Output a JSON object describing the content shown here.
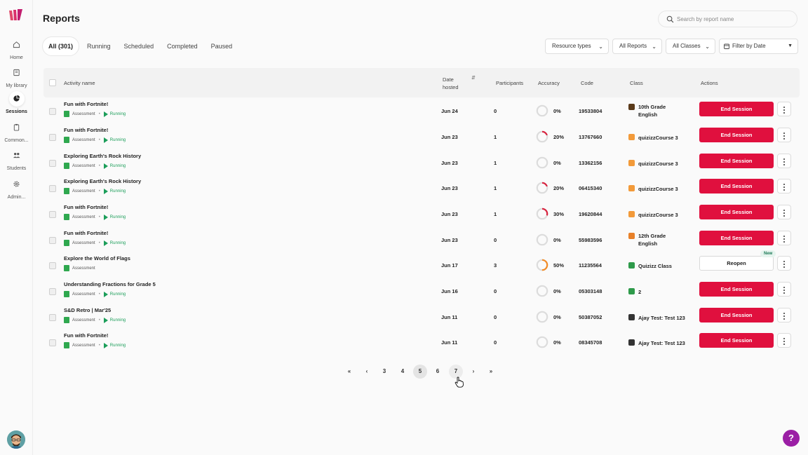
{
  "sidebar": {
    "items": [
      {
        "label": "Home",
        "icon": "home-icon"
      },
      {
        "label": "My library",
        "icon": "library-icon"
      },
      {
        "label": "Sessions",
        "icon": "sessions-icon",
        "active": true
      },
      {
        "label": "Common...",
        "icon": "clipboard-icon"
      },
      {
        "label": "Students",
        "icon": "students-icon"
      },
      {
        "label": "Admin...",
        "icon": "gear-icon"
      }
    ]
  },
  "header": {
    "title": "Reports",
    "search_placeholder": "Search by report name"
  },
  "tabs": [
    {
      "label": "All (301)",
      "active": true
    },
    {
      "label": "Running"
    },
    {
      "label": "Scheduled"
    },
    {
      "label": "Completed"
    },
    {
      "label": "Paused"
    }
  ],
  "filters": {
    "resource_types": "Resource types",
    "all_reports": "All Reports",
    "all_classes": "All Classes",
    "date": "Filter by Date"
  },
  "table": {
    "headers": {
      "activity": "Activity name",
      "date": "Date hosted",
      "participants": "Participants",
      "accuracy": "Accuracy",
      "code": "Code",
      "class": "Class",
      "actions": "Actions"
    },
    "rows": [
      {
        "name": "Fun with Fortnite!",
        "type": "Assessment",
        "status": "Running",
        "date": "Jun 24",
        "participants": "0",
        "accuracy": "0%",
        "accuracy_value": 0,
        "code": "19533804",
        "class": "10th Grade English",
        "class_color": "#5a3a1a",
        "action": "End Session"
      },
      {
        "name": "Fun with Fortnite!",
        "type": "Assessment",
        "status": "Running",
        "date": "Jun 23",
        "participants": "1",
        "accuracy": "20%",
        "accuracy_value": 20,
        "code": "13767660",
        "class": "quizizzCourse 3",
        "class_color": "#f29a3a",
        "action": "End Session"
      },
      {
        "name": "Exploring Earth's Rock History",
        "type": "Assessment",
        "status": "Running",
        "date": "Jun 23",
        "participants": "1",
        "accuracy": "0%",
        "accuracy_value": 0,
        "code": "13362156",
        "class": "quizizzCourse 3",
        "class_color": "#f29a3a",
        "action": "End Session"
      },
      {
        "name": "Exploring Earth's Rock History",
        "type": "Assessment",
        "status": "Running",
        "date": "Jun 23",
        "participants": "1",
        "accuracy": "20%",
        "accuracy_value": 20,
        "code": "06415340",
        "class": "quizizzCourse 3",
        "class_color": "#f29a3a",
        "action": "End Session"
      },
      {
        "name": "Fun with Fortnite!",
        "type": "Assessment",
        "status": "Running",
        "date": "Jun 23",
        "participants": "1",
        "accuracy": "30%",
        "accuracy_value": 30,
        "code": "19620844",
        "class": "quizizzCourse 3",
        "class_color": "#f29a3a",
        "action": "End Session"
      },
      {
        "name": "Fun with Fortnite!",
        "type": "Assessment",
        "status": "Running",
        "date": "Jun 23",
        "participants": "0",
        "accuracy": "0%",
        "accuracy_value": 0,
        "code": "55983596",
        "class": "12th Grade English",
        "class_color": "#e8812a",
        "action": "End Session"
      },
      {
        "name": "Explore the World of Flags",
        "type": "Assessment",
        "status": "",
        "date": "Jun 17",
        "participants": "3",
        "accuracy": "50%",
        "accuracy_value": 50,
        "code": "11235564",
        "class": "Quizizz Class",
        "class_color": "#2e9a4a",
        "action": "Reopen",
        "badge": "New"
      },
      {
        "name": "Understanding Fractions for Grade 5",
        "type": "Assessment",
        "status": "Running",
        "date": "Jun 16",
        "participants": "0",
        "accuracy": "0%",
        "accuracy_value": 0,
        "code": "05303148",
        "class": "2",
        "class_color": "#2e9a4a",
        "action": "End Session"
      },
      {
        "name": "S&D Retro | Mar'25",
        "type": "Assessment",
        "status": "Running",
        "date": "Jun 11",
        "participants": "0",
        "accuracy": "0%",
        "accuracy_value": 0,
        "code": "50387052",
        "class": "Ajay Test: Test 123",
        "class_color": "#333333",
        "action": "End Session"
      },
      {
        "name": "Fun with Fortnite!",
        "type": "Assessment",
        "status": "Running",
        "date": "Jun 11",
        "participants": "0",
        "accuracy": "0%",
        "accuracy_value": 0,
        "code": "08345708",
        "class": "Ajay Test: Test 123",
        "class_color": "#333333",
        "action": "End Session"
      }
    ]
  },
  "pagination": {
    "pages": [
      "3",
      "4",
      "5",
      "6",
      "7"
    ],
    "current": "5",
    "hover": "7"
  },
  "help": {
    "label": "?"
  },
  "colors": {
    "accent_red": "#e0103e",
    "running_green": "#1c9e5a",
    "accuracy_orange": "#f28c28",
    "accuracy_red": "#d8233f",
    "help_purple": "#9b1fa5"
  }
}
